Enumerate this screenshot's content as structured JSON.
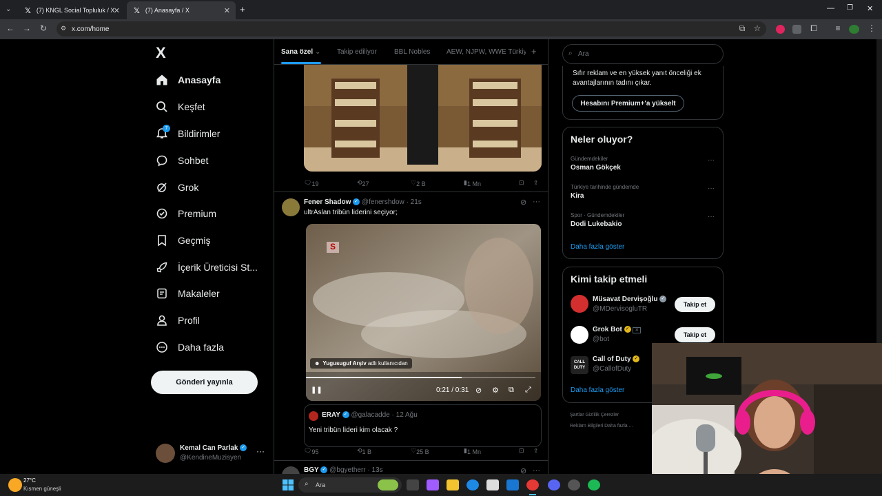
{
  "browser": {
    "tabs": [
      {
        "title": "(7) KNGL Social Topluluk / X",
        "active": false
      },
      {
        "title": "(7) Anasayfa / X",
        "active": true
      }
    ],
    "url": "x.com/home"
  },
  "nav": {
    "logo": "X",
    "items": [
      {
        "label": "Anasayfa",
        "icon": "home-icon"
      },
      {
        "label": "Keşfet",
        "icon": "search-icon"
      },
      {
        "label": "Bildirimler",
        "icon": "bell-icon",
        "badge": "7"
      },
      {
        "label": "Sohbet",
        "icon": "chat-icon"
      },
      {
        "label": "Grok",
        "icon": "grok-icon"
      },
      {
        "label": "Premium",
        "icon": "premium-icon"
      },
      {
        "label": "Geçmiş",
        "icon": "bookmark-icon"
      },
      {
        "label": "İçerik Üreticisi St...",
        "icon": "rocket-icon"
      },
      {
        "label": "Makaleler",
        "icon": "article-icon"
      },
      {
        "label": "Profil",
        "icon": "profile-icon"
      },
      {
        "label": "Daha fazla",
        "icon": "more-circle-icon"
      }
    ],
    "post_button": "Gönderi yayınla",
    "account": {
      "name": "Kemal Can Parlak",
      "handle": "@KendineMuzisyen"
    }
  },
  "timeline": {
    "tabs": [
      "Sana özel",
      "Takip ediliyor",
      "BBL Nobles",
      "AEW, NJPW, WWE Türkiy"
    ],
    "post1_stats": {
      "replies": "19",
      "reposts": "27",
      "likes": "2 B",
      "views": "1 Mn"
    },
    "post2": {
      "name": "Fener Shadow",
      "handle": "@fenershdow",
      "time": "· 21s",
      "text": "ultrAslan tribün liderini seçiyor;",
      "video_credit_user": "Yugusuguf Arşiv",
      "video_credit_suffix": "adlı kullanıcıdan",
      "video_time": "0:21 / 0:31",
      "video_progress": 0.68,
      "quote": {
        "name": "ERAY",
        "handle": "@galacadde",
        "time": "· 12 Ağu",
        "text": "Yeni tribün lideri kim olacak ?"
      },
      "stats": {
        "replies": "95",
        "reposts": "1 B",
        "likes": "25 B",
        "views": "1 Mn"
      }
    },
    "post3": {
      "name": "BGY",
      "handle": "@bgyetherr",
      "time": "· 13s"
    }
  },
  "sidebar": {
    "search_placeholder": "Ara",
    "premium_text_1": "Sıfır reklam ve en yüksek yanıt önceliği ek",
    "premium_text_2": "avantajlarının tadını çıkar.",
    "premium_button": "Hesabını Premium+'a yükselt",
    "trends_title": "Neler oluyor?",
    "trends": [
      {
        "category": "Gündemdekiler",
        "name": "Osman Gökçek"
      },
      {
        "category": "Türkiye tarihinde gündemde",
        "name": "Kira"
      },
      {
        "category": "Spor · Gündemdekiler",
        "name": "Dodi Lukebakio"
      }
    ],
    "show_more": "Daha fazla göster",
    "follow_title": "Kimi takip etmeli",
    "follow": [
      {
        "name": "Müsavat Dervişoğlu",
        "handle": "@MDervisogluTR",
        "button": "Takip et"
      },
      {
        "name": "Grok Bot",
        "handle": "@bot",
        "button": "Takip et"
      },
      {
        "name": "Call of Duty",
        "handle": "@CallofDuty"
      }
    ],
    "footer_1": "Şartlar    Gizlilik    Çerezler",
    "footer_2": "Reklam Bilgileri    Daha fazla ..."
  },
  "taskbar": {
    "weather_temp": "27°C",
    "weather_desc": "Kısmen güneşli",
    "search": "Ara"
  }
}
